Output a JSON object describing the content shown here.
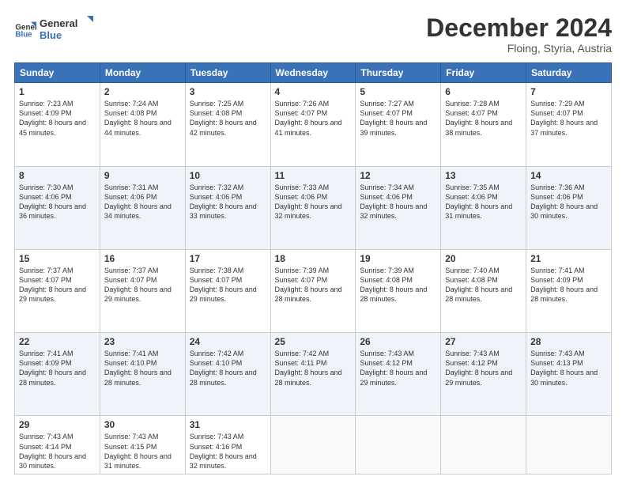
{
  "header": {
    "logo": {
      "line1": "General",
      "line2": "Blue"
    },
    "title": "December 2024",
    "location": "Floing, Styria, Austria"
  },
  "weekdays": [
    "Sunday",
    "Monday",
    "Tuesday",
    "Wednesday",
    "Thursday",
    "Friday",
    "Saturday"
  ],
  "weeks": [
    [
      {
        "day": "1",
        "sunrise": "7:23 AM",
        "sunset": "4:09 PM",
        "daylight": "8 hours and 45 minutes."
      },
      {
        "day": "2",
        "sunrise": "7:24 AM",
        "sunset": "4:08 PM",
        "daylight": "8 hours and 44 minutes."
      },
      {
        "day": "3",
        "sunrise": "7:25 AM",
        "sunset": "4:08 PM",
        "daylight": "8 hours and 42 minutes."
      },
      {
        "day": "4",
        "sunrise": "7:26 AM",
        "sunset": "4:07 PM",
        "daylight": "8 hours and 41 minutes."
      },
      {
        "day": "5",
        "sunrise": "7:27 AM",
        "sunset": "4:07 PM",
        "daylight": "8 hours and 39 minutes."
      },
      {
        "day": "6",
        "sunrise": "7:28 AM",
        "sunset": "4:07 PM",
        "daylight": "8 hours and 38 minutes."
      },
      {
        "day": "7",
        "sunrise": "7:29 AM",
        "sunset": "4:07 PM",
        "daylight": "8 hours and 37 minutes."
      }
    ],
    [
      {
        "day": "8",
        "sunrise": "7:30 AM",
        "sunset": "4:06 PM",
        "daylight": "8 hours and 36 minutes."
      },
      {
        "day": "9",
        "sunrise": "7:31 AM",
        "sunset": "4:06 PM",
        "daylight": "8 hours and 34 minutes."
      },
      {
        "day": "10",
        "sunrise": "7:32 AM",
        "sunset": "4:06 PM",
        "daylight": "8 hours and 33 minutes."
      },
      {
        "day": "11",
        "sunrise": "7:33 AM",
        "sunset": "4:06 PM",
        "daylight": "8 hours and 32 minutes."
      },
      {
        "day": "12",
        "sunrise": "7:34 AM",
        "sunset": "4:06 PM",
        "daylight": "8 hours and 32 minutes."
      },
      {
        "day": "13",
        "sunrise": "7:35 AM",
        "sunset": "4:06 PM",
        "daylight": "8 hours and 31 minutes."
      },
      {
        "day": "14",
        "sunrise": "7:36 AM",
        "sunset": "4:06 PM",
        "daylight": "8 hours and 30 minutes."
      }
    ],
    [
      {
        "day": "15",
        "sunrise": "7:37 AM",
        "sunset": "4:07 PM",
        "daylight": "8 hours and 29 minutes."
      },
      {
        "day": "16",
        "sunrise": "7:37 AM",
        "sunset": "4:07 PM",
        "daylight": "8 hours and 29 minutes."
      },
      {
        "day": "17",
        "sunrise": "7:38 AM",
        "sunset": "4:07 PM",
        "daylight": "8 hours and 29 minutes."
      },
      {
        "day": "18",
        "sunrise": "7:39 AM",
        "sunset": "4:07 PM",
        "daylight": "8 hours and 28 minutes."
      },
      {
        "day": "19",
        "sunrise": "7:39 AM",
        "sunset": "4:08 PM",
        "daylight": "8 hours and 28 minutes."
      },
      {
        "day": "20",
        "sunrise": "7:40 AM",
        "sunset": "4:08 PM",
        "daylight": "8 hours and 28 minutes."
      },
      {
        "day": "21",
        "sunrise": "7:41 AM",
        "sunset": "4:09 PM",
        "daylight": "8 hours and 28 minutes."
      }
    ],
    [
      {
        "day": "22",
        "sunrise": "7:41 AM",
        "sunset": "4:09 PM",
        "daylight": "8 hours and 28 minutes."
      },
      {
        "day": "23",
        "sunrise": "7:41 AM",
        "sunset": "4:10 PM",
        "daylight": "8 hours and 28 minutes."
      },
      {
        "day": "24",
        "sunrise": "7:42 AM",
        "sunset": "4:10 PM",
        "daylight": "8 hours and 28 minutes."
      },
      {
        "day": "25",
        "sunrise": "7:42 AM",
        "sunset": "4:11 PM",
        "daylight": "8 hours and 28 minutes."
      },
      {
        "day": "26",
        "sunrise": "7:43 AM",
        "sunset": "4:12 PM",
        "daylight": "8 hours and 29 minutes."
      },
      {
        "day": "27",
        "sunrise": "7:43 AM",
        "sunset": "4:12 PM",
        "daylight": "8 hours and 29 minutes."
      },
      {
        "day": "28",
        "sunrise": "7:43 AM",
        "sunset": "4:13 PM",
        "daylight": "8 hours and 30 minutes."
      }
    ],
    [
      {
        "day": "29",
        "sunrise": "7:43 AM",
        "sunset": "4:14 PM",
        "daylight": "8 hours and 30 minutes."
      },
      {
        "day": "30",
        "sunrise": "7:43 AM",
        "sunset": "4:15 PM",
        "daylight": "8 hours and 31 minutes."
      },
      {
        "day": "31",
        "sunrise": "7:43 AM",
        "sunset": "4:16 PM",
        "daylight": "8 hours and 32 minutes."
      },
      null,
      null,
      null,
      null
    ]
  ],
  "labels": {
    "sunrise": "Sunrise:",
    "sunset": "Sunset:",
    "daylight": "Daylight:"
  }
}
